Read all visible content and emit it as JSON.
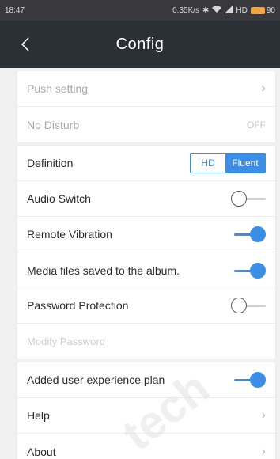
{
  "status_bar": {
    "time": "18:47",
    "speed": "0.35K/s",
    "icons": [
      "bluetooth-icon",
      "wifi-icon",
      "signal-icon"
    ],
    "network": "HD",
    "battery": "90"
  },
  "header": {
    "title": "Config",
    "back_icon": "chevron-left-icon"
  },
  "groups": {
    "push": {
      "push_setting": "Push setting",
      "no_disturb": "No Disturb",
      "no_disturb_value": "OFF"
    },
    "media": {
      "definition": "Definition",
      "definition_options": [
        "HD",
        "Fluent"
      ],
      "definition_selected": "Fluent",
      "audio_switch": "Audio Switch",
      "audio_switch_on": false,
      "remote_vibration": "Remote Vibration",
      "remote_vibration_on": true,
      "media_saved": "Media files saved to the album.",
      "media_saved_on": true
    },
    "security": {
      "password_protection": "Password Protection",
      "password_protection_on": false,
      "modify_password": "Modify Password"
    },
    "other": {
      "experience_plan": "Added user experience plan",
      "experience_plan_on": true,
      "help": "Help",
      "about": "About"
    }
  },
  "watermark": "tech",
  "colors": {
    "accent": "#3b8ee6",
    "header_bg": "#2b2f36",
    "background": "#f0f0f0"
  }
}
